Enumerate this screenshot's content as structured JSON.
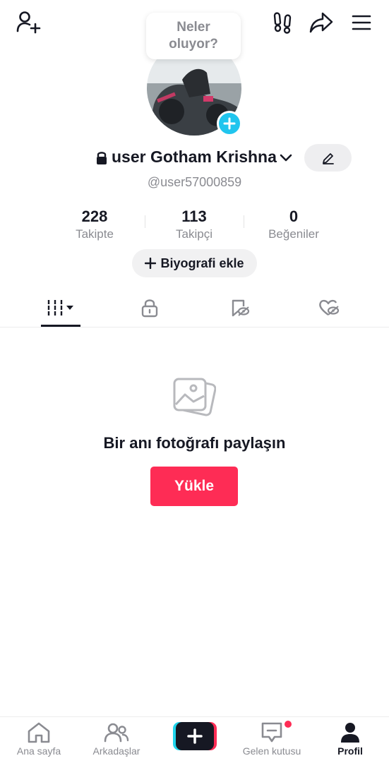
{
  "tooltip": {
    "line1": "Neler",
    "line2": "oluyor?"
  },
  "profile": {
    "display_name": "user Gotham Krishna",
    "username": "@user57000859"
  },
  "stats": [
    {
      "value": "228",
      "label": "Takipte"
    },
    {
      "value": "113",
      "label": "Takipçi"
    },
    {
      "value": "0",
      "label": "Beğeniler"
    }
  ],
  "bio_button": {
    "label": "Biyografi ekle"
  },
  "tabs": [
    {
      "icon": "grid-icon",
      "selected": true
    },
    {
      "icon": "lock-icon",
      "selected": false
    },
    {
      "icon": "repost-icon",
      "selected": false
    },
    {
      "icon": "liked-icon",
      "selected": false
    }
  ],
  "empty_state": {
    "message": "Bir anı fotoğrafı paylaşın",
    "button_label": "Yükle"
  },
  "bottom_nav": [
    {
      "label": "Ana sayfa",
      "icon": "home-icon"
    },
    {
      "label": "Arkadaşlar",
      "icon": "friends-icon"
    },
    {
      "label": "",
      "icon": "create-icon"
    },
    {
      "label": "Gelen kutusu",
      "icon": "inbox-icon",
      "badge": true
    },
    {
      "label": "Profil",
      "icon": "profile-icon",
      "active": true
    }
  ],
  "colors": {
    "accent": "#fe2c55",
    "cyan": "#20c5ee",
    "text": "#161823",
    "muted": "#8a8b91"
  }
}
